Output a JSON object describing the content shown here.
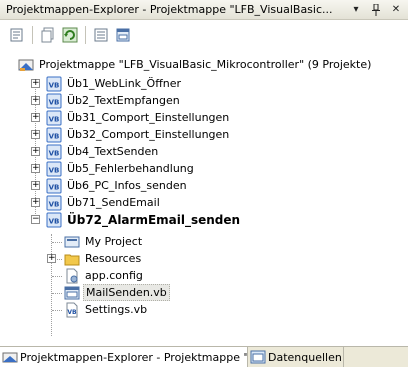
{
  "window": {
    "title": "Projektmappen-Explorer - Projektmappe \"LFB_VisualBasic...",
    "dropdown_icon": "chevron-down-icon",
    "pin_icon": "pin-icon",
    "close_icon": "close-icon"
  },
  "toolbar": {
    "buttons": [
      {
        "icon": "properties-icon"
      },
      {
        "icon": "show-all-files-icon"
      },
      {
        "icon": "refresh-icon"
      },
      {
        "icon": "view-code-icon"
      },
      {
        "icon": "view-designer-icon"
      }
    ]
  },
  "tree": {
    "solution": {
      "label": "Projektmappe \"LFB_VisualBasic_Mikrocontroller\" (9 Projekte)"
    },
    "projects": [
      {
        "label": "Üb1_WebLink_Öffner",
        "expanded": false
      },
      {
        "label": "Üb2_TextEmpfangen",
        "expanded": false
      },
      {
        "label": "Üb31_Comport_Einstellungen",
        "expanded": false
      },
      {
        "label": "Üb32_Comport_Einstellungen",
        "expanded": false
      },
      {
        "label": "Üb4_TextSenden",
        "expanded": false
      },
      {
        "label": "Üb5_Fehlerbehandlung",
        "expanded": false
      },
      {
        "label": "Üb6_PC_Infos_senden",
        "expanded": false
      },
      {
        "label": "Üb71_SendEmail",
        "expanded": false
      },
      {
        "label": "Üb72_AlarmEmail_senden",
        "expanded": true,
        "bold": true
      }
    ],
    "children": [
      {
        "label": "My Project",
        "icon": "my-project-icon"
      },
      {
        "label": "Resources",
        "icon": "folder-icon",
        "expandable": true
      },
      {
        "label": "app.config",
        "icon": "config-file-icon"
      },
      {
        "label": "MailSenden.vb",
        "icon": "form-file-icon",
        "selected": true
      },
      {
        "label": "Settings.vb",
        "icon": "vb-file-icon"
      }
    ]
  },
  "bottom_tabs": [
    {
      "label": "Projektmappen-Explorer - Projektmappe \"LFB...",
      "active": true
    },
    {
      "label": "Datenquellen",
      "active": false
    }
  ],
  "colors": {
    "project_icon_blue": "#3a6fc4",
    "folder_yellow": "#f2c84b",
    "selection": "#e8e8e4"
  }
}
